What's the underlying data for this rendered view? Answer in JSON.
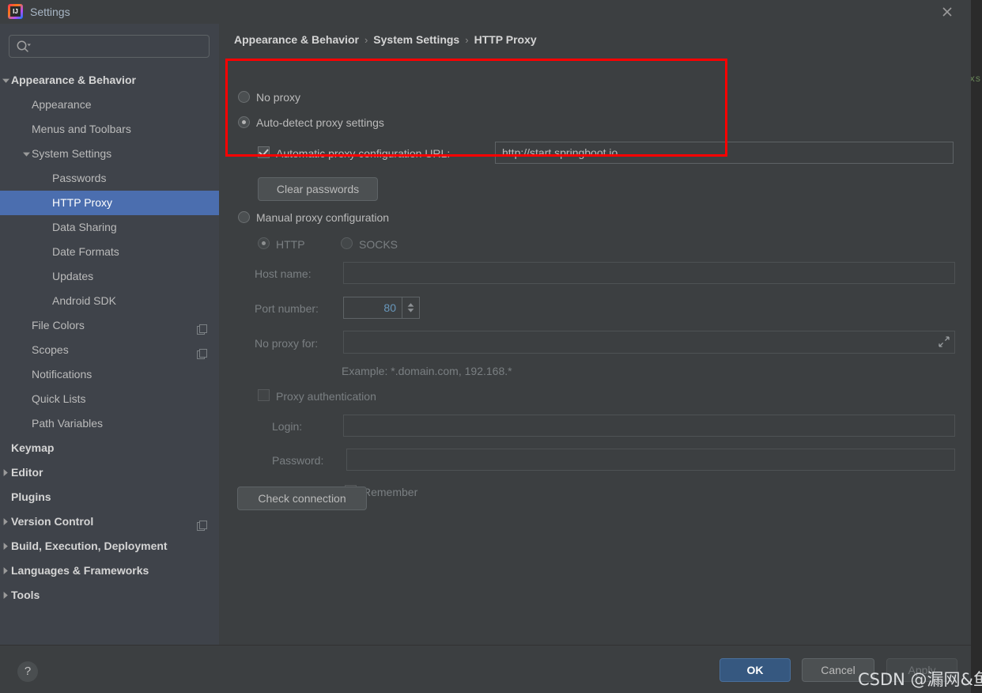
{
  "window": {
    "title": "Settings",
    "logo_icon": "intellij-idea-logo",
    "close_icon": "close-icon"
  },
  "sidebar": {
    "search": {
      "placeholder": "",
      "value": "",
      "icon": "search-icon"
    },
    "items": [
      {
        "label": "Appearance & Behavior",
        "depth": 0,
        "arrow": "down",
        "bold": true,
        "selected": false,
        "badge": false
      },
      {
        "label": "Appearance",
        "depth": 1,
        "arrow": "none",
        "bold": false,
        "selected": false,
        "badge": false
      },
      {
        "label": "Menus and Toolbars",
        "depth": 1,
        "arrow": "none",
        "bold": false,
        "selected": false,
        "badge": false
      },
      {
        "label": "System Settings",
        "depth": 1,
        "arrow": "down",
        "bold": false,
        "selected": false,
        "badge": false
      },
      {
        "label": "Passwords",
        "depth": 2,
        "arrow": "none",
        "bold": false,
        "selected": false,
        "badge": false
      },
      {
        "label": "HTTP Proxy",
        "depth": 2,
        "arrow": "none",
        "bold": false,
        "selected": true,
        "badge": false
      },
      {
        "label": "Data Sharing",
        "depth": 2,
        "arrow": "none",
        "bold": false,
        "selected": false,
        "badge": false
      },
      {
        "label": "Date Formats",
        "depth": 2,
        "arrow": "none",
        "bold": false,
        "selected": false,
        "badge": false
      },
      {
        "label": "Updates",
        "depth": 2,
        "arrow": "none",
        "bold": false,
        "selected": false,
        "badge": false
      },
      {
        "label": "Android SDK",
        "depth": 2,
        "arrow": "none",
        "bold": false,
        "selected": false,
        "badge": false
      },
      {
        "label": "File Colors",
        "depth": 1,
        "arrow": "none",
        "bold": false,
        "selected": false,
        "badge": true
      },
      {
        "label": "Scopes",
        "depth": 1,
        "arrow": "none",
        "bold": false,
        "selected": false,
        "badge": true
      },
      {
        "label": "Notifications",
        "depth": 1,
        "arrow": "none",
        "bold": false,
        "selected": false,
        "badge": false
      },
      {
        "label": "Quick Lists",
        "depth": 1,
        "arrow": "none",
        "bold": false,
        "selected": false,
        "badge": false
      },
      {
        "label": "Path Variables",
        "depth": 1,
        "arrow": "none",
        "bold": false,
        "selected": false,
        "badge": false
      },
      {
        "label": "Keymap",
        "depth": 0,
        "arrow": "none",
        "bold": true,
        "selected": false,
        "badge": false
      },
      {
        "label": "Editor",
        "depth": 0,
        "arrow": "right",
        "bold": true,
        "selected": false,
        "badge": false
      },
      {
        "label": "Plugins",
        "depth": 0,
        "arrow": "none",
        "bold": true,
        "selected": false,
        "badge": false
      },
      {
        "label": "Version Control",
        "depth": 0,
        "arrow": "right",
        "bold": true,
        "selected": false,
        "badge": true
      },
      {
        "label": "Build, Execution, Deployment",
        "depth": 0,
        "arrow": "right",
        "bold": true,
        "selected": false,
        "badge": false
      },
      {
        "label": "Languages & Frameworks",
        "depth": 0,
        "arrow": "right",
        "bold": true,
        "selected": false,
        "badge": false
      },
      {
        "label": "Tools",
        "depth": 0,
        "arrow": "right",
        "bold": true,
        "selected": false,
        "badge": false
      }
    ]
  },
  "breadcrumb": {
    "items": [
      "Appearance & Behavior",
      "System Settings",
      "HTTP Proxy"
    ],
    "separator": "›"
  },
  "proxy": {
    "no_proxy_label": "No proxy",
    "no_proxy_selected": false,
    "auto_detect_label": "Auto-detect proxy settings",
    "auto_detect_selected": true,
    "pac_checkbox_label": "Automatic proxy configuration URL:",
    "pac_checked": true,
    "pac_url_value": "http://start.springboot.io",
    "clear_passwords_label": "Clear passwords",
    "manual_label": "Manual proxy configuration",
    "manual_selected": false,
    "http_label": "HTTP",
    "http_selected": true,
    "socks_label": "SOCKS",
    "socks_selected": false,
    "host_name_label": "Host name:",
    "host_name_value": "",
    "port_number_label": "Port number:",
    "port_number_value": "80",
    "no_proxy_for_label": "No proxy for:",
    "no_proxy_for_value": "",
    "no_proxy_for_expand_icon": "expand-icon",
    "example_text": "Example: *.domain.com, 192.168.*",
    "proxy_auth_label": "Proxy authentication",
    "proxy_auth_checked": false,
    "login_label": "Login:",
    "login_value": "",
    "password_label": "Password:",
    "password_value": "",
    "remember_label": "Remember",
    "remember_checked": false,
    "check_connection_label": "Check connection"
  },
  "footer": {
    "help_icon": "help-question-icon",
    "ok_label": "OK",
    "cancel_label": "Cancel",
    "apply_label": "Apply"
  },
  "overlay": {
    "watermark": "CSDN @漏网&鱼",
    "behind_ide_text": "xs"
  },
  "colors": {
    "selection": "#4b6eaf",
    "highlight_box": "#ff0000",
    "ok_button": "#365880",
    "value_blue": "#6897bb"
  }
}
